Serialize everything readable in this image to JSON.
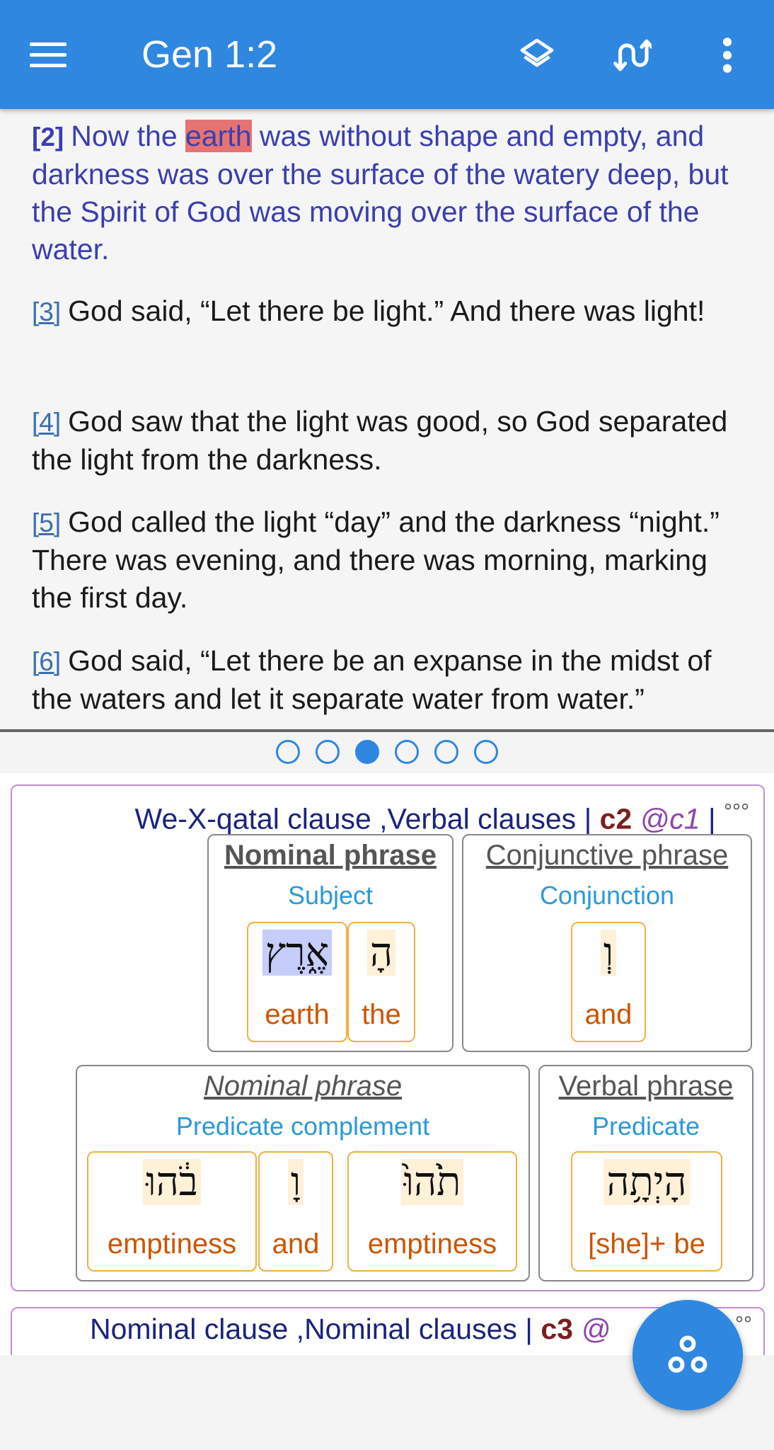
{
  "appbar": {
    "title": "Gen 1:2",
    "icons": [
      "menu-icon",
      "layers-icon",
      "sync-icon",
      "more-vert-icon"
    ]
  },
  "verses": [
    {
      "num": "[2]",
      "before": "Now the ",
      "highlight": "earth",
      "after": " was without shape and empty, and darkness was over the surface of the watery deep, but the Spirit of God was moving over the surface of the water.",
      "current": true
    },
    {
      "num": "[3]",
      "text": "God said, “Let there be light.” And there was light!"
    },
    {
      "num": "[4]",
      "text": "God saw that the light was good, so God separated the light from the darkness."
    },
    {
      "num": "[5]",
      "text": "God called the light “day” and the darkness “night.” There was evening, and there was morning, marking the first day."
    },
    {
      "num": "[6]",
      "text": "God said, “Let there be an expanse in the midst of the waters and let it separate water from water.”"
    }
  ],
  "pager": {
    "count": 6,
    "active": 3
  },
  "clauses": [
    {
      "label": "We-X-qatal clause ,Verbal clauses",
      "sep1": " | ",
      "id": "c2",
      "ref": " @c1",
      "sep2": " | ",
      "more": "°°°",
      "phrases": [
        {
          "type": "Nominal phrase",
          "function": "Subject",
          "words": [
            {
              "hebrew": "אֶ֑רֶץ",
              "gloss": "earth"
            },
            {
              "hebrew": "הָ",
              "gloss": "the"
            }
          ]
        },
        {
          "type": "Conjunctive phrase",
          "function": "Conjunction",
          "words": [
            {
              "hebrew": "וְ",
              "gloss": "and"
            }
          ]
        },
        {
          "type": "Nominal phrase",
          "function": "Predicate complement",
          "words": [
            {
              "hebrew": "בֹ֔הוּ",
              "gloss": "emptiness"
            },
            {
              "hebrew": "וָ",
              "gloss": "and"
            },
            {
              "hebrew": "תֹ֙הוּ֙",
              "gloss": "emptiness"
            }
          ]
        },
        {
          "type": "Verbal phrase",
          "function": "Predicate",
          "words": [
            {
              "hebrew": "הָיְתָ֥ה",
              "gloss": "[she]+ be"
            }
          ]
        }
      ]
    },
    {
      "label": "Nominal clause ,Nominal clauses",
      "sep1": " | ",
      "id": "c3",
      "ref": " @",
      "more": "°°"
    }
  ],
  "fab": {
    "icon": "tree-nodes-icon"
  }
}
